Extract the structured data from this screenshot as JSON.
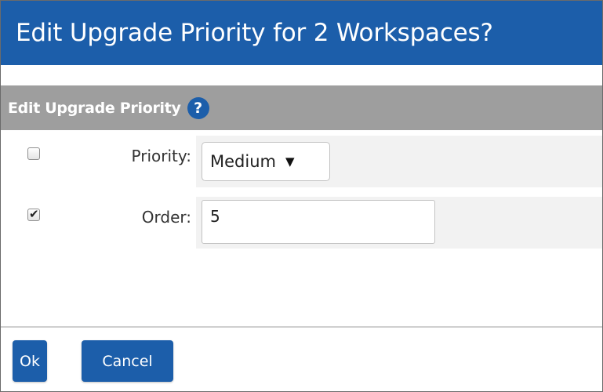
{
  "dialog": {
    "title": "Edit Upgrade Priority for 2 Workspaces?"
  },
  "section": {
    "header_label": "Edit Upgrade Priority",
    "help_icon_glyph": "?"
  },
  "fields": {
    "priority": {
      "checked": false,
      "label": "Priority:",
      "selected_value": "Medium",
      "arrow_glyph": "▼"
    },
    "order": {
      "checked": true,
      "check_glyph": "✔",
      "label": "Order:",
      "value": "5"
    }
  },
  "buttons": {
    "ok_label": "Ok",
    "cancel_label": "Cancel"
  },
  "colors": {
    "title_bar": "#1c5eaa",
    "section_header": "#9e9e9e",
    "button": "#1c5eaa",
    "row_shade": "#f2f2f2"
  }
}
